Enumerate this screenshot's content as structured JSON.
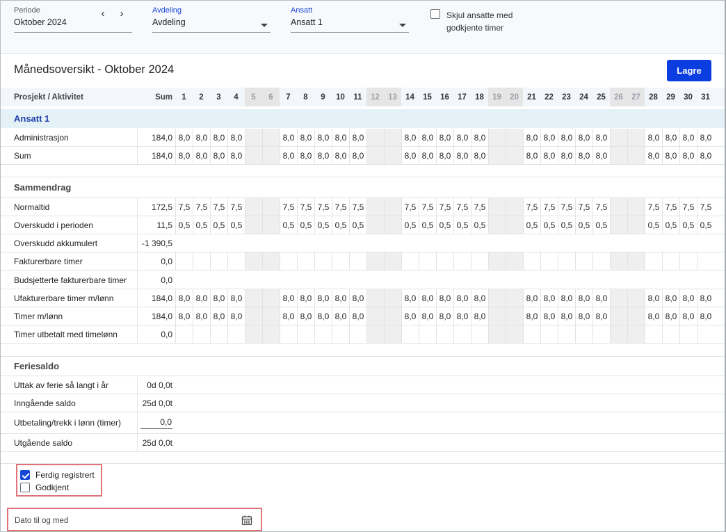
{
  "filters": {
    "periode_label": "Periode",
    "periode_value": "Oktober 2024",
    "avdeling_label": "Avdeling",
    "avdeling_value": "Avdeling",
    "ansatt_label": "Ansatt",
    "ansatt_value": "Ansatt 1",
    "skjul_label": "Skjul ansatte med godkjente timer",
    "skjul_checked": false
  },
  "title": "Månedsoversikt - Oktober 2024",
  "save_label": "Lagre",
  "header": {
    "project_col": "Prosjekt / Aktivitet",
    "sum_col": "Sum",
    "days": [
      "1",
      "2",
      "3",
      "4",
      "5",
      "6",
      "7",
      "8",
      "9",
      "10",
      "11",
      "12",
      "13",
      "14",
      "15",
      "16",
      "17",
      "18",
      "19",
      "20",
      "21",
      "22",
      "23",
      "24",
      "25",
      "26",
      "27",
      "28",
      "29",
      "30",
      "31"
    ],
    "weekend_days": [
      5,
      6,
      12,
      13,
      19,
      20,
      26,
      27
    ]
  },
  "group_title": "Ansatt 1",
  "activity_rows": [
    {
      "label": "Administrasjon",
      "sum": "184,0",
      "value": "8,0"
    },
    {
      "label": "Sum",
      "sum": "184,0",
      "value": "8,0"
    }
  ],
  "summary_title": "Sammendrag",
  "summary_rows": [
    {
      "label": "Normaltid",
      "sum": "172,5",
      "value": "7,5",
      "grid": true
    },
    {
      "label": "Overskudd i perioden",
      "sum": "11,5",
      "value": "0,5",
      "grid": true
    },
    {
      "label": "Overskudd akkumulert",
      "sum": "-1 390,5",
      "value": "",
      "grid": false
    },
    {
      "label": "Fakturerbare timer",
      "sum": "0,0",
      "value": "",
      "grid": true
    },
    {
      "label": "Budsjetterte fakturerbare timer",
      "sum": "0,0",
      "value": "",
      "grid": false
    },
    {
      "label": "Ufakturerbare timer m/lønn",
      "sum": "184,0",
      "value": "8,0",
      "grid": true
    },
    {
      "label": "Timer m/lønn",
      "sum": "184,0",
      "value": "8,0",
      "grid": true
    },
    {
      "label": "Timer utbetalt med timelønn",
      "sum": "0,0",
      "value": "",
      "grid": true
    }
  ],
  "ferie_title": "Feriesaldo",
  "ferie_rows": [
    {
      "label": "Uttak av ferie så langt i år",
      "value": "0d 0,0t"
    },
    {
      "label": "Inngående saldo",
      "value": "25d 0,0t"
    },
    {
      "label": "Utbetaling/trekk i lønn (timer)",
      "value": "0,0",
      "editable": true
    },
    {
      "label": "Utgående saldo",
      "value": "25d 0,0t"
    }
  ],
  "checkboxes": {
    "ferdig_label": "Ferdig registrert",
    "ferdig_checked": true,
    "godkjent_label": "Godkjent",
    "godkjent_checked": false
  },
  "date_field": {
    "placeholder": "Dato til og med",
    "icon": "calendar-icon"
  },
  "colors": {
    "primary": "#0b3ee0",
    "group_bg": "#e4f2f7",
    "weekend_bg": "#efefef",
    "highlight_border": "#e0737a"
  }
}
